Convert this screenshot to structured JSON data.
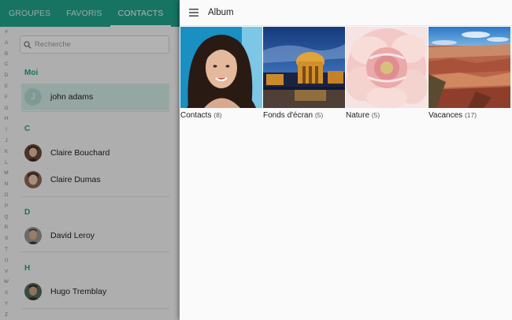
{
  "tabs": [
    {
      "label": "GROUPES",
      "active": false
    },
    {
      "label": "FAVORIS",
      "active": false
    },
    {
      "label": "CONTACTS",
      "active": true
    }
  ],
  "index_letters": [
    "#",
    "A",
    "B",
    "C",
    "D",
    "E",
    "F",
    "G",
    "H",
    "I",
    "J",
    "K",
    "L",
    "M",
    "N",
    "O",
    "P",
    "Q",
    "R",
    "S",
    "T",
    "U",
    "V",
    "W",
    "X",
    "Y",
    "Z"
  ],
  "search": {
    "placeholder": "Recherche",
    "icon": "search-icon"
  },
  "sections": [
    {
      "header": "Moi",
      "contacts": [
        {
          "name": "john adams",
          "initial": "J",
          "selected": true
        }
      ]
    },
    {
      "header": "C",
      "contacts": [
        {
          "name": "Claire Bouchard"
        },
        {
          "name": "Claire Dumas"
        }
      ]
    },
    {
      "header": "D",
      "contacts": [
        {
          "name": "David Leroy"
        }
      ]
    },
    {
      "header": "H",
      "contacts": [
        {
          "name": "Hugo Tremblay"
        }
      ]
    }
  ],
  "app_bar": {
    "title": "Album",
    "menu_icon": "hamburger-menu-icon"
  },
  "albums": [
    {
      "name": "Contacts",
      "count": "(8)"
    },
    {
      "name": "Fonds d'écran",
      "count": "(5)"
    },
    {
      "name": "Nature",
      "count": "(5)"
    },
    {
      "name": "Vacances",
      "count": "(17)"
    }
  ],
  "colors": {
    "accent": "#21a68d",
    "selected_row": "#d6efe9"
  }
}
